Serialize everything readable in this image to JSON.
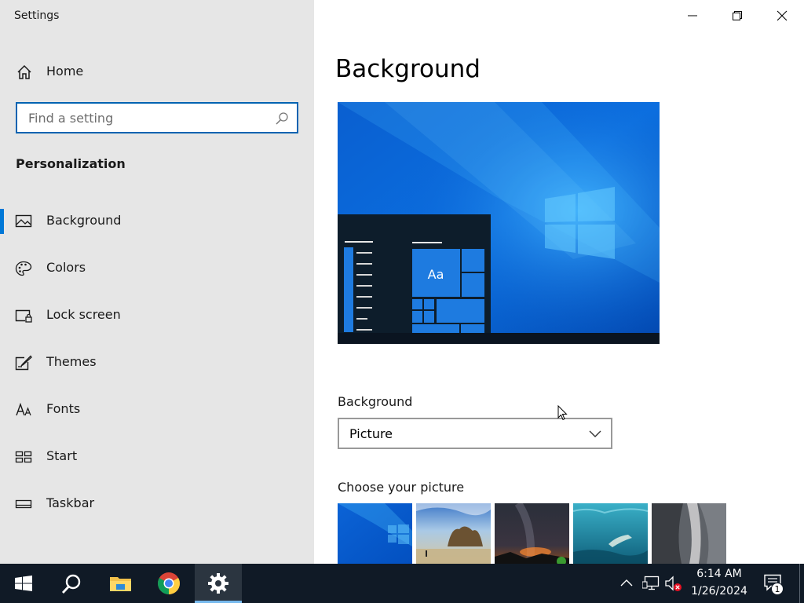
{
  "window": {
    "title": "Settings",
    "controls": {
      "minimize": "minimize",
      "maximize": "restore",
      "close": "close"
    }
  },
  "sidebar": {
    "home_label": "Home",
    "search": {
      "placeholder": "Find a setting",
      "value": ""
    },
    "section_title": "Personalization",
    "items": [
      {
        "label": "Background",
        "icon": "picture-icon",
        "selected": true
      },
      {
        "label": "Colors",
        "icon": "palette-icon",
        "selected": false
      },
      {
        "label": "Lock screen",
        "icon": "lock-screen-icon",
        "selected": false
      },
      {
        "label": "Themes",
        "icon": "brush-icon",
        "selected": false
      },
      {
        "label": "Fonts",
        "icon": "font-icon",
        "selected": false
      },
      {
        "label": "Start",
        "icon": "start-menu-icon",
        "selected": false
      },
      {
        "label": "Taskbar",
        "icon": "taskbar-icon",
        "selected": false
      }
    ]
  },
  "main": {
    "page_title": "Background",
    "preview": {
      "sample_text": "Aa"
    },
    "background_field": {
      "label": "Background",
      "selected_value": "Picture"
    },
    "choose_picture_label": "Choose your picture",
    "thumbnails": [
      "windows-blue-wallpaper",
      "beach-rocks",
      "night-sky",
      "underwater-swimmer",
      "rock-cliff"
    ]
  },
  "taskbar": {
    "apps": [
      "start-button",
      "search-button",
      "file-explorer",
      "chrome",
      "settings"
    ],
    "active_app": "settings",
    "clock": {
      "time": "6:14 AM",
      "date": "1/26/2024"
    },
    "notification_count": "1"
  },
  "colors": {
    "accent": "#0078d7",
    "sidebar_bg": "#e6e6e6",
    "taskbar_bg": "#101a26"
  }
}
